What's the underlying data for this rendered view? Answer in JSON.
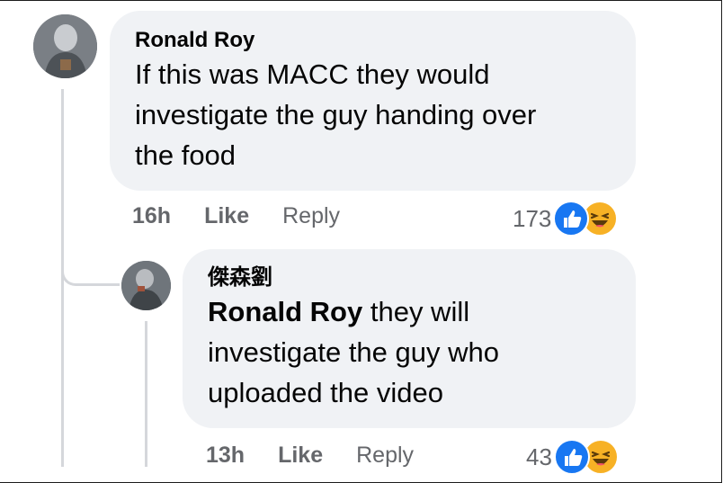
{
  "colors": {
    "bubble": "#f0f2f5",
    "meta_text": "#65676b",
    "like_blue": "#1877f2",
    "haha_yellow": "#f7b125",
    "thread_line": "#d5d7db"
  },
  "comment": {
    "author": "Ronald Roy",
    "text_lines": [
      "If this was MACC they would",
      "investigate the guy handing over",
      "the food"
    ],
    "time": "16h",
    "like_label": "Like",
    "reply_label": "Reply",
    "reaction_count": "173",
    "reaction_icons": [
      "like-icon",
      "haha-icon"
    ]
  },
  "reply": {
    "author": "傑森劉",
    "mention": "Ronald Roy",
    "text_first_line_rest": " they will",
    "text_lines": [
      "investigate the guy who",
      "uploaded the video"
    ],
    "time": "13h",
    "like_label": "Like",
    "reply_label": "Reply",
    "reaction_count": "43",
    "reaction_icons": [
      "like-icon",
      "haha-icon"
    ]
  }
}
